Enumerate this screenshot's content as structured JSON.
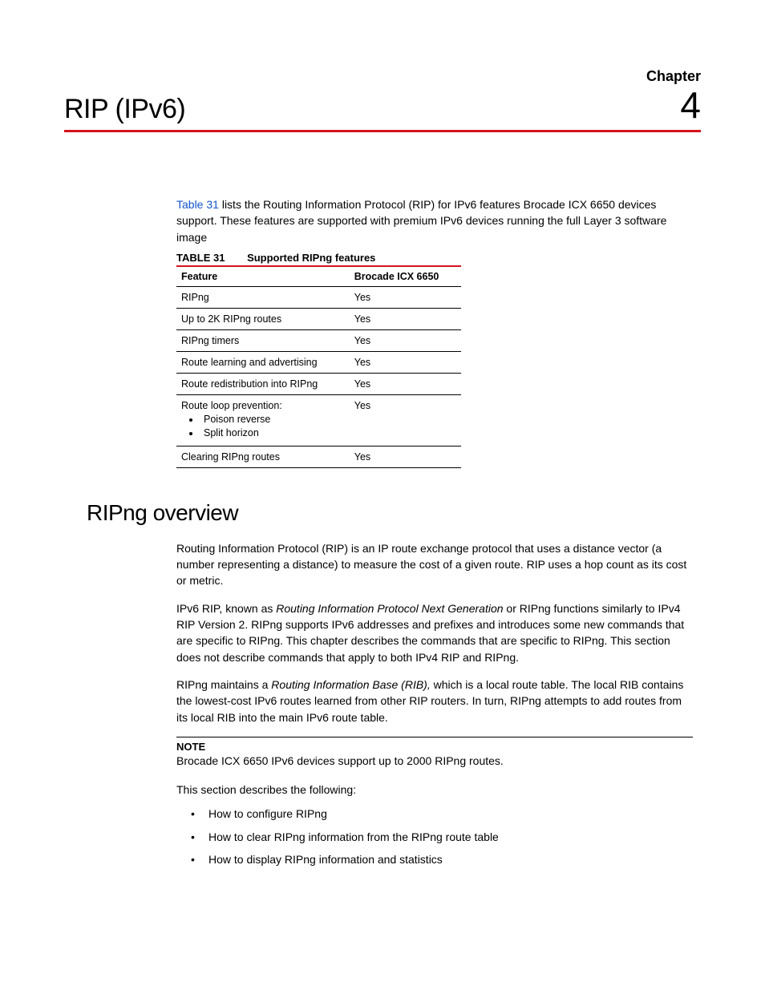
{
  "header": {
    "chapter_label": "Chapter",
    "title": "RIP (IPv6)",
    "chapter_number": "4"
  },
  "intro": {
    "link_text": "Table 31",
    "text_after_link": " lists the Routing Information Protocol (RIP) for IPv6 features  Brocade ICX 6650 devices support. These features are supported with premium IPv6 devices running the full Layer 3 software image"
  },
  "table": {
    "caption_num": "TABLE 31",
    "caption_title": "Supported RIPng features",
    "headers": [
      "Feature",
      "Brocade ICX 6650"
    ],
    "rows": [
      {
        "feature": "RIPng",
        "value": "Yes",
        "sub": []
      },
      {
        "feature": "Up to 2K RIPng routes",
        "value": "Yes",
        "sub": []
      },
      {
        "feature": "RIPng timers",
        "value": "Yes",
        "sub": []
      },
      {
        "feature": "Route learning and advertising",
        "value": "Yes",
        "sub": []
      },
      {
        "feature": "Route redistribution into RIPng",
        "value": "Yes",
        "sub": []
      },
      {
        "feature": "Route loop prevention:",
        "value": "Yes",
        "sub": [
          "Poison reverse",
          "Split horizon"
        ]
      },
      {
        "feature": "Clearing RIPng routes",
        "value": "Yes",
        "sub": []
      }
    ]
  },
  "section": {
    "heading": "RIPng overview",
    "para1": "Routing Information Protocol (RIP) is an IP route exchange protocol that uses a distance vector (a number representing a distance) to measure the cost of a given route. RIP uses a hop count as its cost or metric.",
    "para2_pre": "IPv6 RIP, known as ",
    "para2_italic": "Routing Information Protocol Next Generation",
    "para2_post": " or RIPng functions similarly to IPv4 RIP Version 2.  RIPng supports IPv6 addresses and prefixes and introduces some new commands that are specific to RIPng.  This chapter describes the commands that are specific to RIPng. This section does not describe commands that apply to both IPv4 RIP and RIPng.",
    "para3_pre": "RIPng maintains a ",
    "para3_italic": "Routing Information Base (RIB),",
    "para3_post": " which is a local route table. The local RIB contains the lowest-cost IPv6 routes learned from other RIP routers. In turn, RIPng attempts to add routes from its local RIB into the main IPv6 route table.",
    "note_label": "NOTE",
    "note_text": "Brocade ICX 6650 IPv6 devices support up to 2000 RIPng routes.",
    "list_intro": "This section describes the following:",
    "bullets": [
      "How to configure RIPng",
      "How to clear RIPng information from the RIPng route table",
      "How to display RIPng information and statistics"
    ]
  }
}
